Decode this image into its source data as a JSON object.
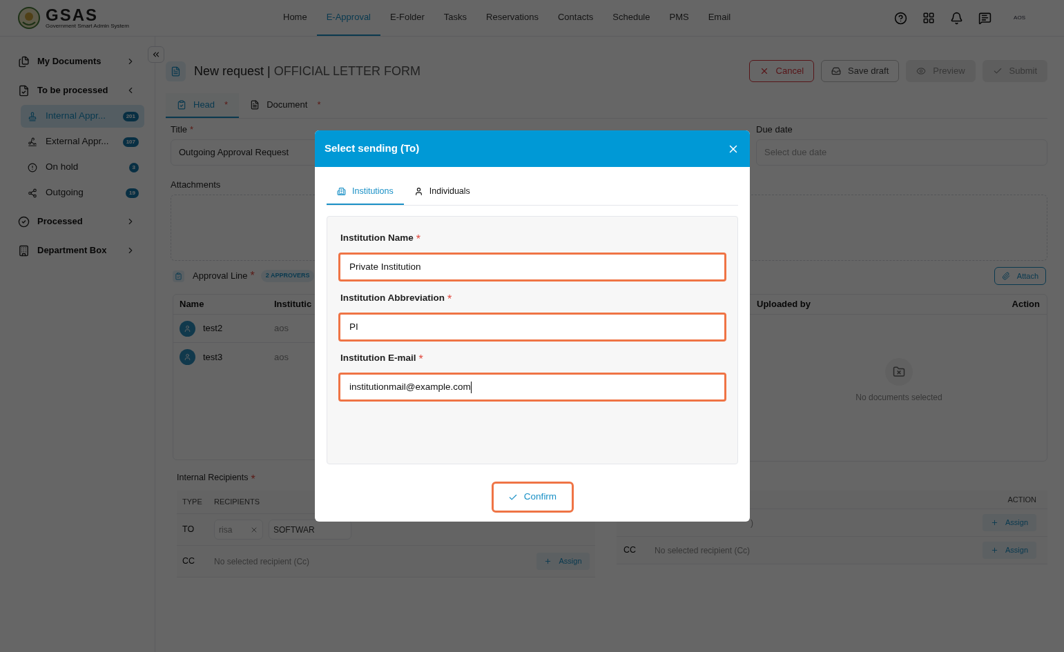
{
  "header": {
    "logo_title": "GSAS",
    "logo_subtitle": "Government Smart Admin System",
    "nav": [
      {
        "label": "Home",
        "selected": false
      },
      {
        "label": "E-Approval",
        "selected": true
      },
      {
        "label": "E-Folder",
        "selected": false
      },
      {
        "label": "Tasks",
        "selected": false
      },
      {
        "label": "Reservations",
        "selected": false
      },
      {
        "label": "Contacts",
        "selected": false
      },
      {
        "label": "Schedule",
        "selected": false
      },
      {
        "label": "PMS",
        "selected": false
      },
      {
        "label": "Email",
        "selected": false
      }
    ],
    "user_badge": "AOS"
  },
  "sidebar": {
    "items": [
      {
        "label": "My Documents",
        "expanded": false
      },
      {
        "label": "To be processed",
        "expanded": true,
        "children": [
          {
            "label": "Internal Appr...",
            "count": "201",
            "selected": true
          },
          {
            "label": "External Appr...",
            "count": "107",
            "selected": false
          },
          {
            "label": "On hold",
            "count": "3",
            "selected": false
          },
          {
            "label": "Outgoing",
            "count": "19",
            "selected": false
          }
        ]
      },
      {
        "label": "Processed",
        "expanded": false
      },
      {
        "label": "Department Box",
        "expanded": false
      }
    ]
  },
  "page": {
    "title": "New request",
    "separator": "|",
    "subtitle": "OFFICIAL LETTER FORM",
    "buttons": [
      {
        "label": "Cancel",
        "kind": "cancel",
        "disabled": false
      },
      {
        "label": "Save draft",
        "kind": "draft",
        "disabled": false
      },
      {
        "label": "Preview",
        "kind": "preview",
        "disabled": true
      },
      {
        "label": "Submit",
        "kind": "submit",
        "disabled": true
      }
    ]
  },
  "tabs": [
    {
      "label": "Head",
      "required_mark": "*",
      "selected": true
    },
    {
      "label": "Document",
      "required_mark": "*",
      "selected": false
    }
  ],
  "form": {
    "title_field": {
      "label": "Title",
      "required_mark": "*",
      "value": "Outgoing Approval Request"
    },
    "due_date": {
      "label": "Due date",
      "placeholder": "Select due date"
    },
    "attachments_label": "Attachments",
    "attach_button": "Attach"
  },
  "approval_line": {
    "label": "Approval Line",
    "required_mark": "*",
    "badge": "2 APPROVERS",
    "columns": [
      "Name",
      "Institutic"
    ],
    "rows": [
      {
        "name": "test2",
        "institution": "aos"
      },
      {
        "name": "test3",
        "institution": "aos"
      }
    ]
  },
  "documents": {
    "columns": [
      "Uploaded by",
      "Action"
    ],
    "empty_text": "No documents selected"
  },
  "internal_recipients": {
    "label": "Internal Recipients",
    "required_mark": "*",
    "columns": [
      "TYPE",
      "RECIPIENTS"
    ],
    "rows": [
      {
        "type": "TO",
        "chips": [
          {
            "label": "risa",
            "removable": true
          },
          {
            "label": "SOFTWAR",
            "removable": false
          }
        ]
      },
      {
        "type": "CC",
        "empty_text": "No selected recipient (Cc)",
        "assign": "Assign"
      }
    ]
  },
  "external_recipients": {
    "columns": [
      "ACTION"
    ],
    "rows": [
      {
        "empty_text": ")",
        "assign": "Assign"
      },
      {
        "type": "CC",
        "empty_text": "No selected recipient (Cc)",
        "assign": "Assign"
      }
    ]
  },
  "modal": {
    "title": "Select sending (To)",
    "tabs": [
      {
        "label": "Institutions",
        "selected": true
      },
      {
        "label": "Individuals",
        "selected": false
      }
    ],
    "fields": [
      {
        "label": "Institution Name",
        "required_mark": "*",
        "value": "Private Institution",
        "focused": false
      },
      {
        "label": "Institution Abbreviation",
        "required_mark": "*",
        "value": "PI",
        "focused": false
      },
      {
        "label": "Institution E-mail",
        "required_mark": "*",
        "value": "institutionmail@example.com",
        "focused": true
      }
    ],
    "confirm": "Confirm"
  }
}
